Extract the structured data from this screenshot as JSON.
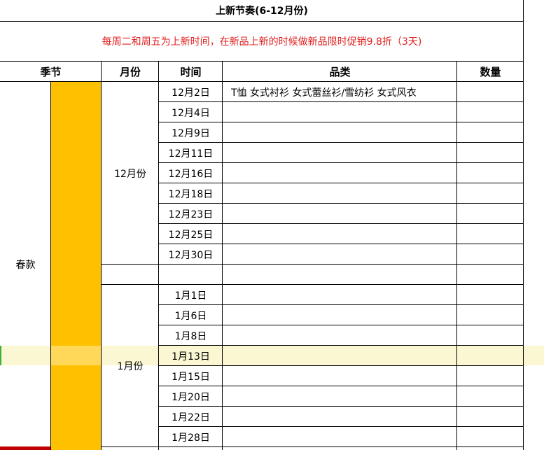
{
  "sheet": {
    "title": "上新节奏(6-12月份)",
    "notice": "每周二和周五为上新时间，在新品上新的时候做新品限时促销9.8折（3天)",
    "headers": {
      "season": "季节",
      "month": "月份",
      "time": "时间",
      "category": "品类",
      "quantity": "数量"
    },
    "season_label": "春款",
    "months": [
      {
        "label": "12月份",
        "dates": [
          "12月2日",
          "12月4日",
          "12月9日",
          "12月11日",
          "12月16日",
          "12月18日",
          "12月23日",
          "12月25日",
          "12月30日"
        ]
      },
      {
        "label": "1月份",
        "dates": [
          "1月1日",
          "1月6日",
          "1月8日",
          "1月13日",
          "1月15日",
          "1月20日",
          "1月22日",
          "1月28日"
        ]
      }
    ],
    "first_row_category": "T恤 女式衬衫  女式蕾丝衫/雪纺衫 女式风衣",
    "colors": {
      "season_fill": "#ffc000",
      "notice_text": "#e02020",
      "selected_row": "#fbf7d2"
    }
  }
}
